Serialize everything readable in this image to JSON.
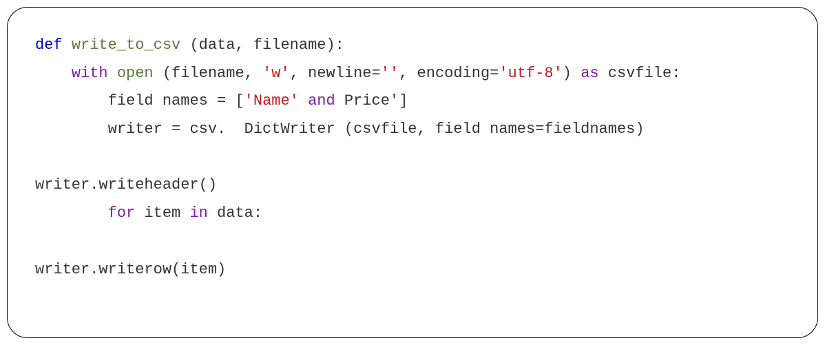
{
  "code": {
    "lines": [
      {
        "indent": "",
        "segments": [
          {
            "cls": "keyword-def",
            "text": "def"
          },
          {
            "cls": "text",
            "text": " "
          },
          {
            "cls": "funcname",
            "text": "write_to_csv"
          },
          {
            "cls": "text",
            "text": " (data, filename):"
          }
        ]
      },
      {
        "indent": "    ",
        "segments": [
          {
            "cls": "keyword-with",
            "text": "with"
          },
          {
            "cls": "text",
            "text": " "
          },
          {
            "cls": "builtin",
            "text": "open"
          },
          {
            "cls": "text",
            "text": " (filename, "
          },
          {
            "cls": "string",
            "text": "'w'"
          },
          {
            "cls": "text",
            "text": ", newline="
          },
          {
            "cls": "string",
            "text": "''"
          },
          {
            "cls": "text",
            "text": ", encoding="
          },
          {
            "cls": "string",
            "text": "'utf-8'"
          },
          {
            "cls": "text",
            "text": ") "
          },
          {
            "cls": "keyword-as",
            "text": "as"
          },
          {
            "cls": "text",
            "text": " csvfile:"
          }
        ]
      },
      {
        "indent": "        ",
        "segments": [
          {
            "cls": "text",
            "text": "field names = ["
          },
          {
            "cls": "string",
            "text": "'Name'"
          },
          {
            "cls": "text",
            "text": " "
          },
          {
            "cls": "keyword-and",
            "text": "and"
          },
          {
            "cls": "text",
            "text": " Price']"
          }
        ]
      },
      {
        "indent": "        ",
        "segments": [
          {
            "cls": "text",
            "text": "writer = csv.  DictWriter (csvfile, field names=fieldnames)"
          }
        ]
      },
      {
        "indent": "",
        "segments": [
          {
            "cls": "text",
            "text": ""
          }
        ]
      },
      {
        "indent": "",
        "segments": [
          {
            "cls": "text",
            "text": "writer.writeheader()"
          }
        ]
      },
      {
        "indent": "        ",
        "segments": [
          {
            "cls": "keyword-for",
            "text": "for"
          },
          {
            "cls": "text",
            "text": " item "
          },
          {
            "cls": "keyword-in",
            "text": "in"
          },
          {
            "cls": "text",
            "text": " data:"
          }
        ]
      },
      {
        "indent": "",
        "segments": [
          {
            "cls": "text",
            "text": ""
          }
        ]
      },
      {
        "indent": "",
        "segments": [
          {
            "cls": "text",
            "text": "writer.writerow(item)"
          }
        ]
      }
    ]
  }
}
